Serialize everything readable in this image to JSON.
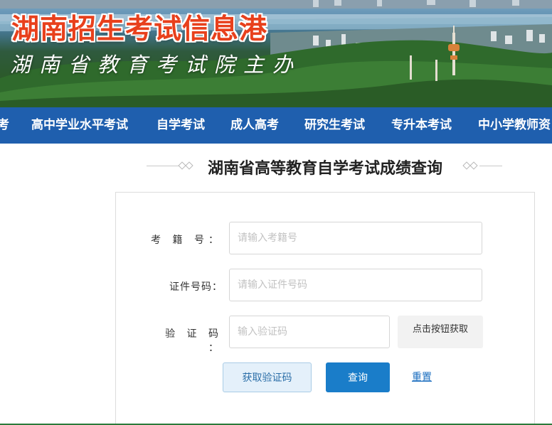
{
  "header": {
    "site_title": "湖南招生考试信息港",
    "site_subtitle": "湖南省教育考试院主办"
  },
  "nav": {
    "items": [
      {
        "label": "考"
      },
      {
        "label": "高中学业水平考试"
      },
      {
        "label": "自学考试"
      },
      {
        "label": "成人高考"
      },
      {
        "label": "研究生考试"
      },
      {
        "label": "专升本考试"
      },
      {
        "label": "中小学教师资"
      }
    ]
  },
  "page": {
    "heading": "湖南省高等教育自学考试成绩查询"
  },
  "form": {
    "exam_id": {
      "label": "考 籍 号：",
      "placeholder": "请输入考籍号",
      "value": ""
    },
    "id_number": {
      "label": "证件号码：",
      "placeholder": "请输入证件号码",
      "value": ""
    },
    "captcha": {
      "label": "验 证 码 ：",
      "placeholder": "输入验证码",
      "value": ""
    },
    "captcha_button_label": "点击按钮获取",
    "fetch_code_label": "获取验证码",
    "query_label": "查询",
    "reset_label": "重置"
  },
  "colors": {
    "nav_bg": "#1f5fae",
    "title_red": "#e8401c",
    "primary_button": "#1a7dc9",
    "link_blue": "#1a6dbf"
  }
}
